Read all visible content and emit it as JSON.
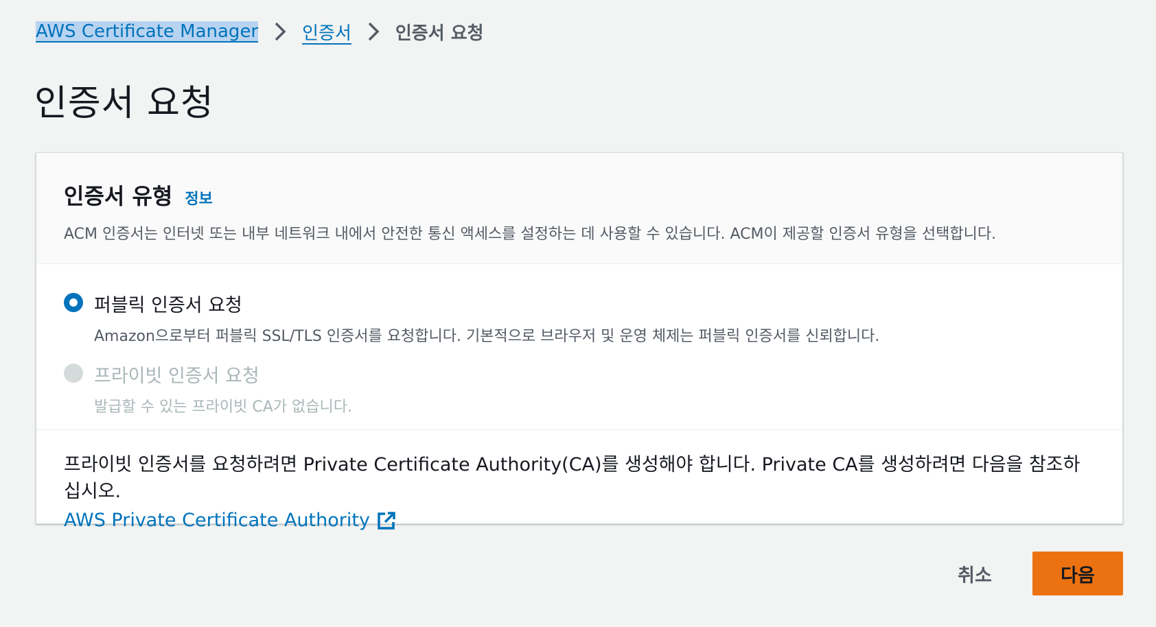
{
  "breadcrumb": {
    "items": [
      "AWS Certificate Manager",
      "인증서"
    ],
    "current": "인증서 요청"
  },
  "page": {
    "title": "인증서 요청"
  },
  "panel": {
    "title": "인증서 유형",
    "info_label": "정보",
    "description": "ACM 인증서는 인터넷 또는 내부 네트워크 내에서 안전한 통신 액세스를 설정하는 데 사용할 수 있습니다. ACM이 제공할 인증서 유형을 선택합니다.",
    "options": [
      {
        "label": "퍼블릭 인증서 요청",
        "description": "Amazon으로부터 퍼블릭 SSL/TLS 인증서를 요청합니다. 기본적으로 브라우저 및 운영 체제는 퍼블릭 인증서를 신뢰합니다.",
        "selected": true,
        "disabled": false
      },
      {
        "label": "프라이빗 인증서 요청",
        "description": "발급할 수 있는 프라이빗 CA가 없습니다.",
        "selected": false,
        "disabled": true
      }
    ],
    "note": "프라이빗 인증서를 요청하려면 Private Certificate Authority(CA)를 생성해야 합니다. Private CA를 생성하려면 다음을 참조하십시오.",
    "link_label": "AWS Private Certificate Authority"
  },
  "actions": {
    "cancel_label": "취소",
    "next_label": "다음"
  },
  "colors": {
    "accent": "#0073bb",
    "primary_button": "#ec7211",
    "background": "#f2f3f3"
  },
  "icons": [
    "chevron-right-icon",
    "external-link-icon"
  ]
}
